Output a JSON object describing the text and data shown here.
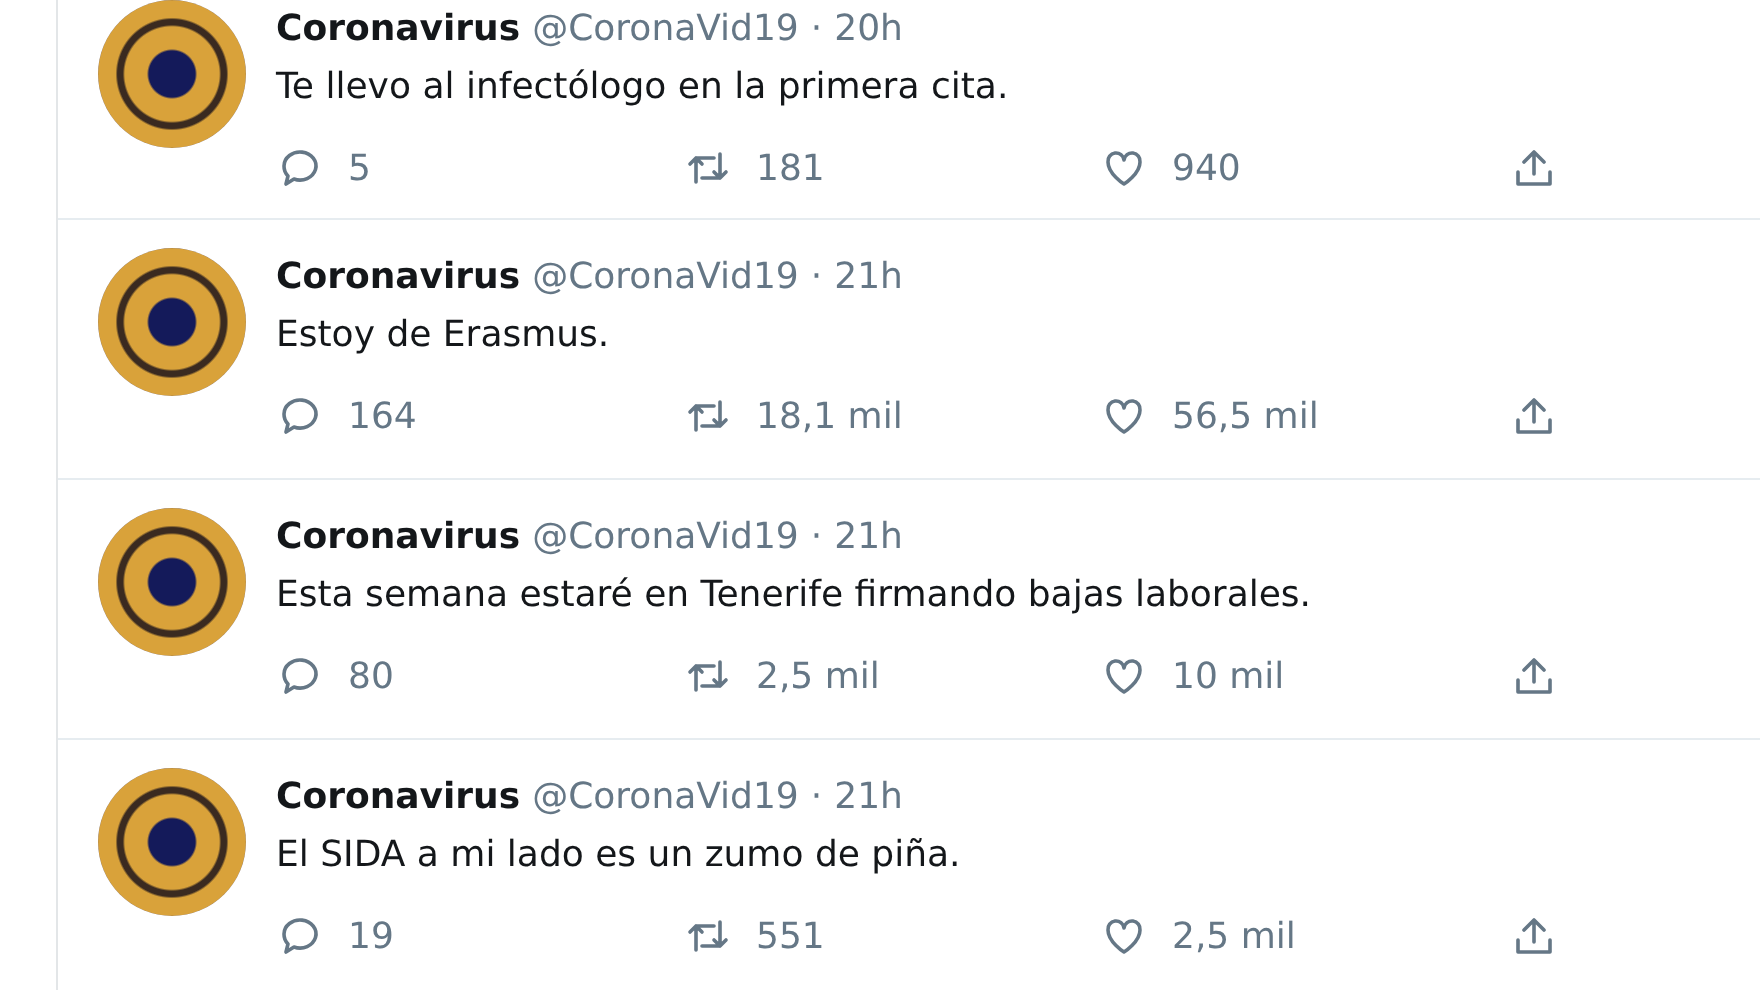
{
  "separator": "·",
  "tweets": [
    {
      "name": "Coronavirus",
      "handle": "@CoronaVid19",
      "time": "20h",
      "text": "Te llevo al infectólogo en la primera cita.",
      "replies": "5",
      "retweets": "181",
      "likes": "940"
    },
    {
      "name": "Coronavirus",
      "handle": "@CoronaVid19",
      "time": "21h",
      "text": "Estoy de Erasmus.",
      "replies": "164",
      "retweets": "18,1 mil",
      "likes": "56,5 mil"
    },
    {
      "name": "Coronavirus",
      "handle": "@CoronaVid19",
      "time": "21h",
      "text": "Esta semana estaré en Tenerife firmando bajas laborales.",
      "replies": "80",
      "retweets": "2,5 mil",
      "likes": "10 mil"
    },
    {
      "name": "Coronavirus",
      "handle": "@CoronaVid19",
      "time": "21h",
      "text": "El SIDA a mi lado es un zumo de piña.",
      "replies": "19",
      "retweets": "551",
      "likes": "2,5 mil"
    }
  ]
}
